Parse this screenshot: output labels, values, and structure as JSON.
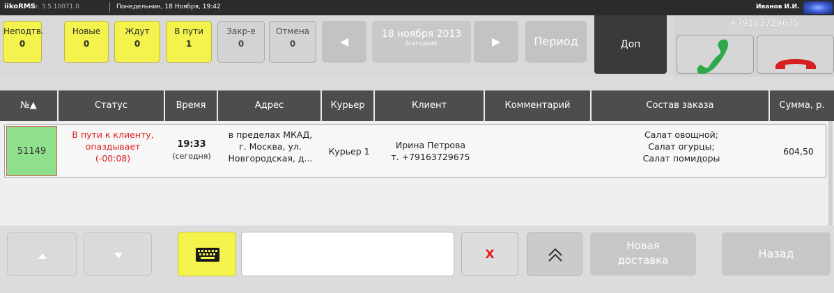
{
  "topbar": {
    "app_name": "iikoRMS",
    "version": "ver. 3.5.10071.0",
    "datetime": "Понедельник, 18 Ноября, 19:42",
    "user": "Иванов И.И."
  },
  "filters": [
    {
      "label": "Неподтв.",
      "count": "0",
      "color": "#f4f24c"
    },
    {
      "label": "Новые",
      "count": "0",
      "color": "#f4f24c"
    },
    {
      "label": "Ждут",
      "count": "0",
      "color": "#f4f24c"
    },
    {
      "label": "В пути",
      "count": "1",
      "color": "#f4f24c"
    },
    {
      "label": "Закр-е",
      "count": "0",
      "color": "#d3d3d3"
    },
    {
      "label": "Отмена",
      "count": "0",
      "color": "#d3d3d3"
    }
  ],
  "date_nav": {
    "prev_icon": "arrow-left-icon",
    "next_icon": "arrow-right-icon",
    "date": "18 ноября 2013",
    "date_note": "(сегодня)",
    "period_label": "Период"
  },
  "dop_label": "Доп",
  "phone": {
    "number": "+79163729675",
    "answer_icon": "phone-answer-icon",
    "hangup_icon": "phone-hangup-icon",
    "answer_color": "#2fa84a",
    "hangup_color": "#d61f1f"
  },
  "table": {
    "columns": [
      "№▲",
      "Статус",
      "Время",
      "Адрес",
      "Курьер",
      "Клиент",
      "Комментарий",
      "Состав заказа",
      "Сумма, р."
    ],
    "rows": [
      {
        "number": "51149",
        "status_lines": [
          "В пути к клиенту,",
          "опаздывает",
          "(-00:08)"
        ],
        "time": "19:33",
        "time_note": "(сегодня)",
        "address_lines": [
          "в пределах МКАД,",
          "г. Москва, ул.",
          "Новгородская, д..."
        ],
        "courier": "Курьер 1",
        "client_name": "Ирина Петрова",
        "client_phone": "т. +79163729675",
        "comment": "",
        "items": [
          "Салат овощной;",
          "Салат огурцы;",
          "Салат помидоры"
        ],
        "sum": "604,50"
      }
    ]
  },
  "bottom": {
    "up_icon": "triangle-up-icon",
    "down_icon": "triangle-down-icon",
    "keyboard_icon": "keyboard-icon",
    "search_value": "",
    "clear_label": "X",
    "collapse_icon": "double-chevron-up-icon",
    "new_delivery_lines": [
      "Новая",
      "доставка"
    ],
    "back_label": "Назад"
  }
}
